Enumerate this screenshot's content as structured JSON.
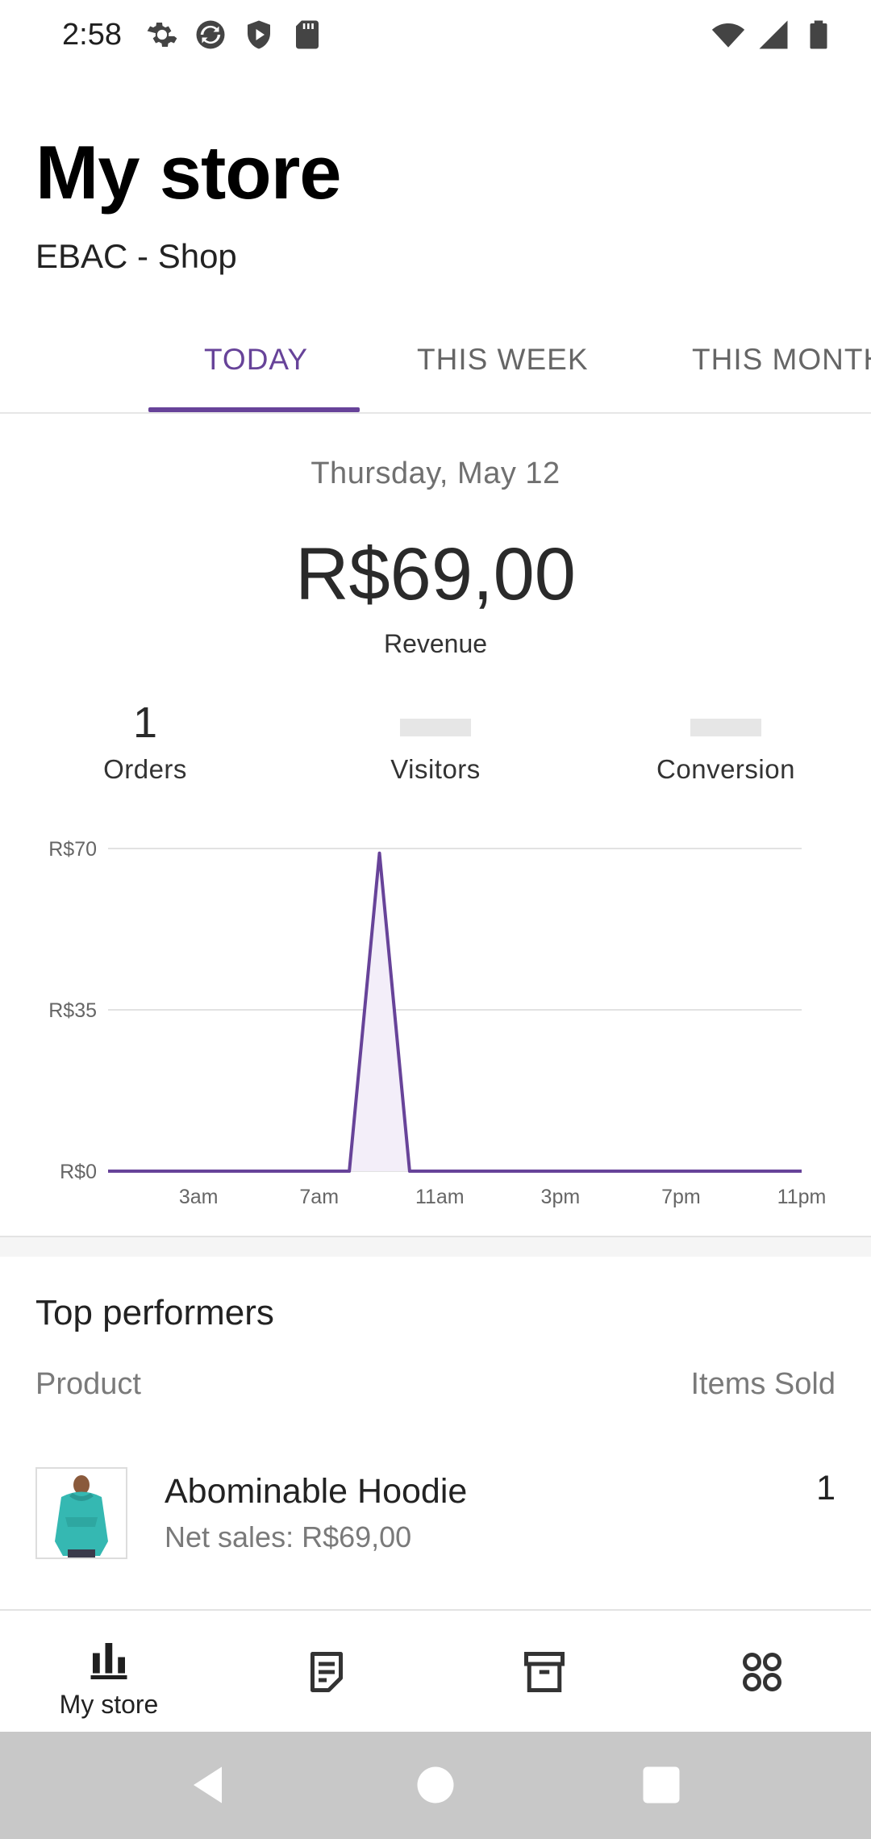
{
  "status_bar": {
    "time": "2:58",
    "left_icons": [
      "settings-icon",
      "sync-icon",
      "shield-icon",
      "sd-card-icon"
    ],
    "right_icons": [
      "wifi-icon",
      "signal-icon",
      "battery-icon"
    ]
  },
  "header": {
    "title": "My store",
    "store_name": "EBAC - Shop"
  },
  "tabs": [
    {
      "label": "TODAY",
      "active": true
    },
    {
      "label": "THIS WEEK",
      "active": false
    },
    {
      "label": "THIS MONTH",
      "active": false
    }
  ],
  "stats": {
    "date": "Thursday, May 12",
    "revenue": "R$69,00",
    "revenue_label": "Revenue",
    "orders_value": "1",
    "orders_label": "Orders",
    "visitors_label": "Visitors",
    "conversion_label": "Conversion"
  },
  "chart_data": {
    "type": "area",
    "x": [
      "12am",
      "1am",
      "2am",
      "3am",
      "4am",
      "5am",
      "6am",
      "7am",
      "8am",
      "9am",
      "10am",
      "11am",
      "12pm",
      "1pm",
      "2pm",
      "3pm",
      "4pm",
      "5pm",
      "6pm",
      "7pm",
      "8pm",
      "9pm",
      "10pm",
      "11pm"
    ],
    "x_tick_labels": [
      "3am",
      "7am",
      "11am",
      "3pm",
      "7pm",
      "11pm"
    ],
    "series": [
      {
        "values": [
          0,
          0,
          0,
          0,
          0,
          0,
          0,
          0,
          0,
          69,
          0,
          0,
          0,
          0,
          0,
          0,
          0,
          0,
          0,
          0,
          0,
          0,
          0,
          0
        ]
      }
    ],
    "y_tick_labels": [
      "R$0",
      "R$35",
      "R$70"
    ],
    "ylim": [
      0,
      70
    ],
    "grid": true,
    "color": "#674399"
  },
  "top_performers": {
    "title": "Top performers",
    "col_product": "Product",
    "col_items": "Items Sold",
    "items": [
      {
        "name": "Abominable Hoodie",
        "net_sales": "Net sales: R$69,00",
        "items_sold": "1"
      }
    ]
  },
  "bottom_nav": [
    {
      "label": "My store",
      "icon": "bar-chart-icon"
    },
    {
      "label": "",
      "icon": "orders-icon"
    },
    {
      "label": "",
      "icon": "products-icon"
    },
    {
      "label": "",
      "icon": "more-icon"
    }
  ],
  "system_nav": [
    "back-icon",
    "home-icon",
    "recents-icon"
  ],
  "colors": {
    "accent": "#674399",
    "muted": "#7a7a7a"
  }
}
